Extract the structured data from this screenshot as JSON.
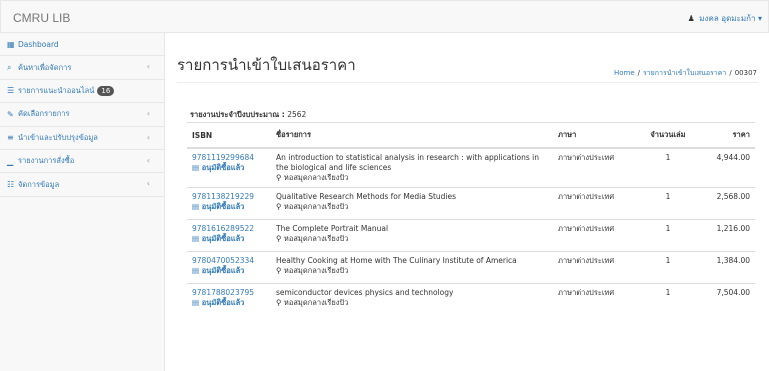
{
  "app": {
    "brand": "CMRU LIB",
    "user_name": "มงคล อุดมะมก้า",
    "user_icon": "user-icon"
  },
  "sidebar": {
    "items": [
      {
        "icon": "▦",
        "label": "Dashboard",
        "chevron": false
      },
      {
        "icon": "⌕",
        "label": "ค้นหาเพื่อจัดการ",
        "chevron": true
      },
      {
        "icon": "☰",
        "label": "รายการแนะนำออนไลน์",
        "chevron": false,
        "badge": "16"
      },
      {
        "icon": "✎",
        "label": "คัดเลือกรายการ",
        "chevron": true
      },
      {
        "icon": "≡",
        "label": "นำเข้าและปรับปรุงข้อมูล",
        "chevron": true
      },
      {
        "icon": "▁",
        "label": "รายงานการสั่งซื้อ",
        "chevron": true
      },
      {
        "icon": "☷",
        "label": "จัดการข้อมูล",
        "chevron": true
      }
    ]
  },
  "main": {
    "title": "รายการนำเข้าใบเสนอราคา",
    "breadcrumb": {
      "home": "Home",
      "section": "รายการนำเข้าใบเสนอราคา",
      "current": "00307"
    },
    "report_label": "รายงานประจำปีงบประมาณ :",
    "report_year": "2562"
  },
  "table": {
    "headers": {
      "isbn": "ISBN",
      "title": "ชื่อรายการ",
      "lang": "ภาษา",
      "qty": "จำนวนเล่ม",
      "price": "ราคา"
    },
    "status_label": "อนุมัติซื้อแล้ว",
    "rows": [
      {
        "isbn": "9781119299684",
        "title": "An introduction to statistical analysis in research : with applications in the biological and life sciences",
        "location": "หอสมุดกลางเรียงปัว",
        "lang": "ภาษาต่างประเทศ",
        "qty": "1",
        "price": "4,944.00"
      },
      {
        "isbn": "9781138219229",
        "title": "Qualitative Research Methods for Media Studies",
        "location": "หอสมุดกลางเรียงปัว",
        "lang": "ภาษาต่างประเทศ",
        "qty": "1",
        "price": "2,568.00"
      },
      {
        "isbn": "9781616289522",
        "title": "The Complete Portrait Manual",
        "location": "หอสมุดกลางเรียงปัว",
        "lang": "ภาษาต่างประเทศ",
        "qty": "1",
        "price": "1,216.00"
      },
      {
        "isbn": "9780470052334",
        "title": "Healthy Cooking at Home with The Culinary Institute of America",
        "location": "หอสมุดกลางเรียงปัว",
        "lang": "ภาษาต่างประเทศ",
        "qty": "1",
        "price": "1,384.00"
      },
      {
        "isbn": "9781788023795",
        "title": "semiconductor devices physics and technology",
        "location": "หอสมุดกลางเรียงปัว",
        "lang": "ภาษาต่างประเทศ",
        "qty": "1",
        "price": "7,504.00"
      }
    ]
  },
  "colors": {
    "link": "#337ab7",
    "navbar_bg": "#f8f8f8",
    "border": "#e7e7e7"
  }
}
